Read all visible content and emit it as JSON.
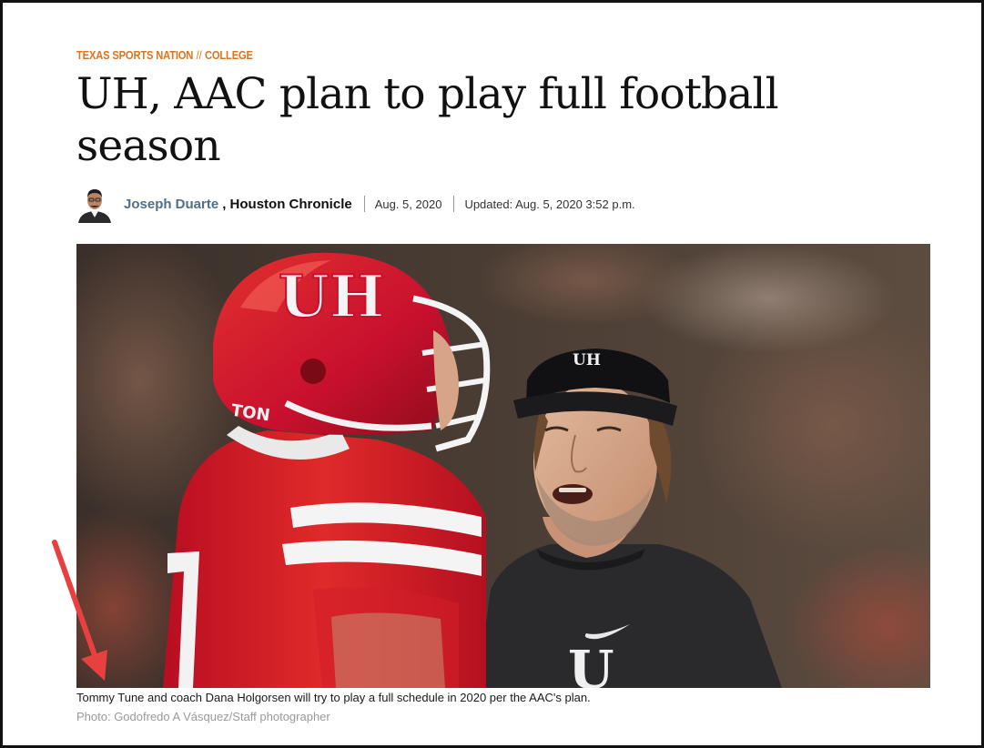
{
  "kicker": {
    "section": "TEXAS SPORTS NATION",
    "separator": "//",
    "category": "COLLEGE"
  },
  "article": {
    "headline": "UH, AAC plan to play full football season"
  },
  "byline": {
    "author": "Joseph Duarte",
    "publication": ", Houston Chronicle",
    "published": "Aug. 5, 2020",
    "updated": "Updated: Aug. 5, 2020 3:52 p.m."
  },
  "photo": {
    "helmet_logo": "UH",
    "visor_logo": "UH",
    "shirt_logo": "U",
    "jersey_text": "TON",
    "caption": "Tommy Tune and coach Dana Holgorsen will try to play a full schedule in 2020 per the AAC's plan.",
    "credit": "Photo: Godofredo A Vásquez/Staff photographer"
  },
  "colors": {
    "kicker_orange": "#e0731c",
    "author_link": "#4f6f8a",
    "annotation_arrow": "#e8403f",
    "uh_red": "#c8102e"
  }
}
